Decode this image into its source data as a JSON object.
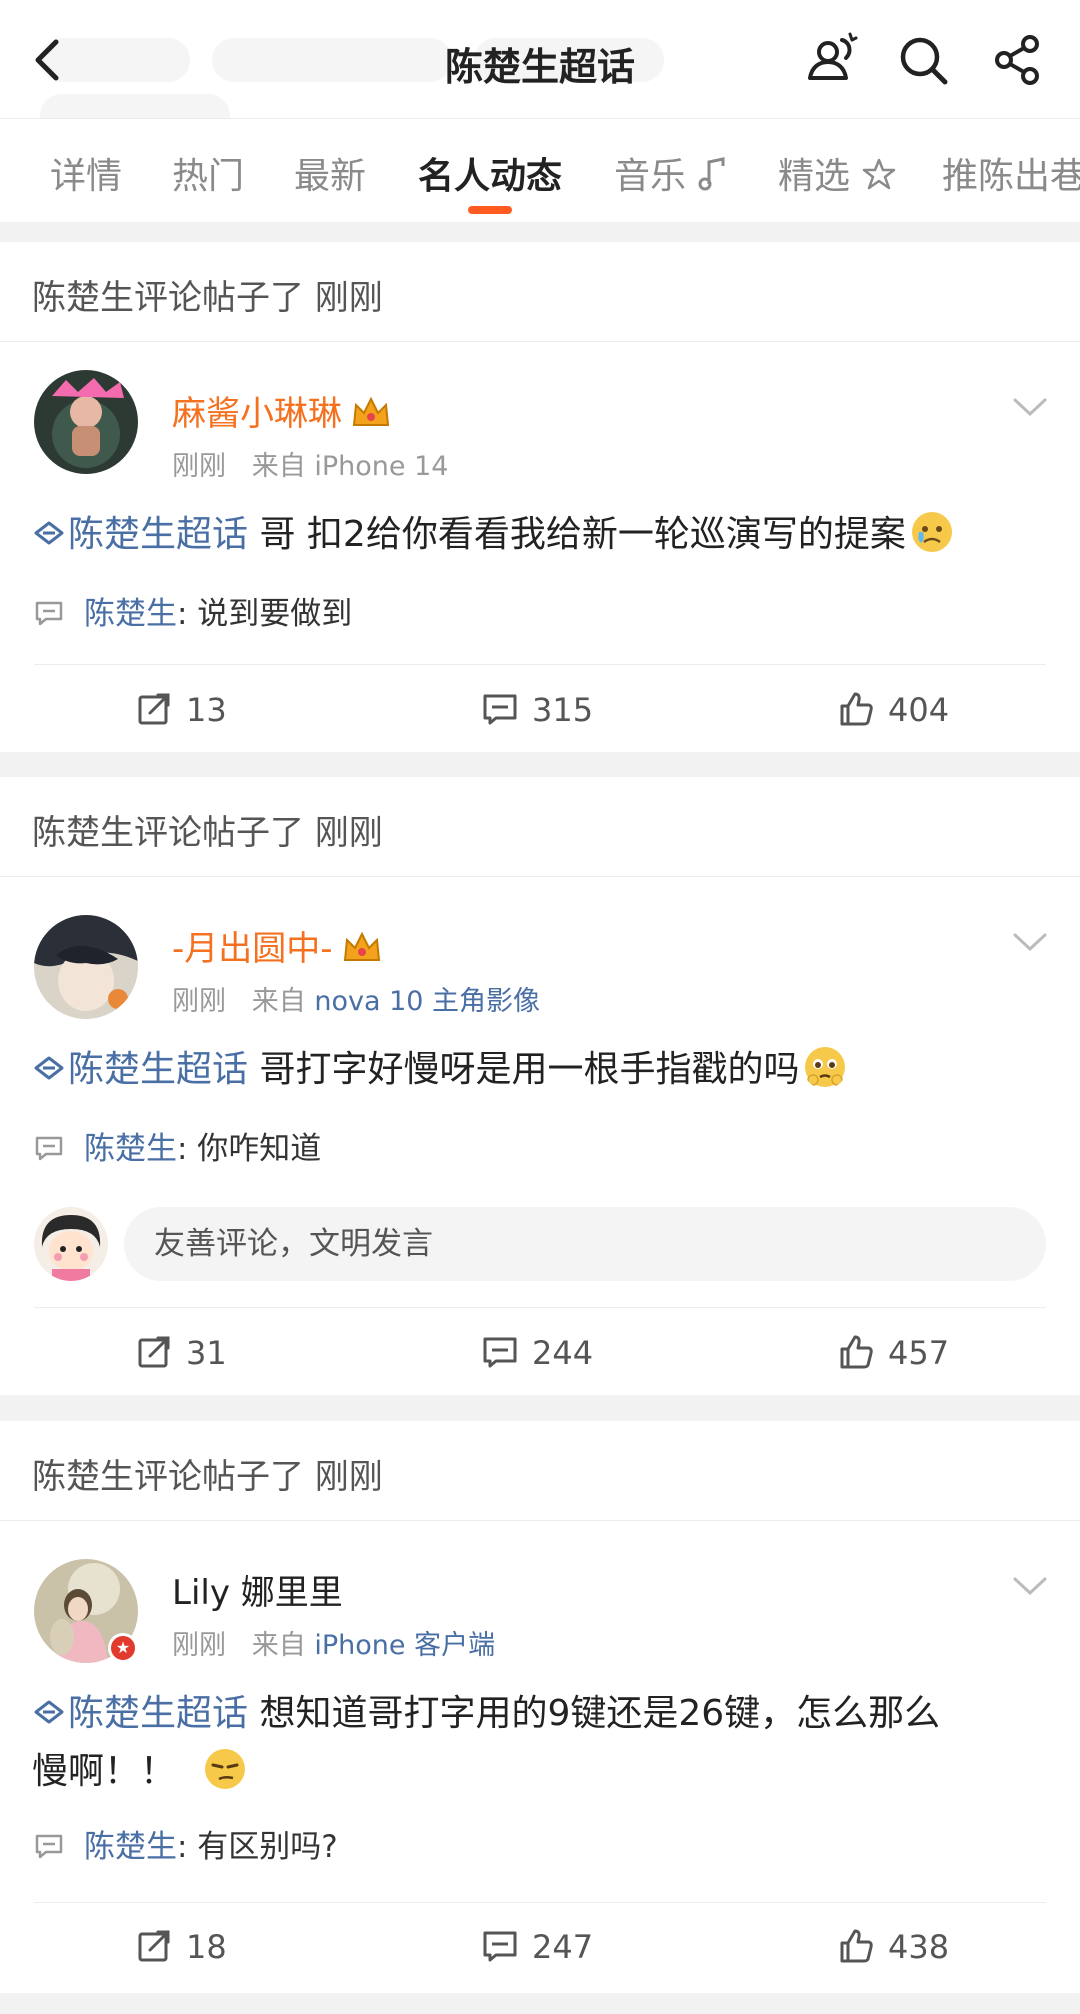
{
  "header": {
    "title": "陈楚生超话",
    "icons": [
      "back-icon",
      "members-icon",
      "search-icon",
      "share-icon"
    ]
  },
  "tabs": [
    {
      "label": "详情"
    },
    {
      "label": "热门"
    },
    {
      "label": "最新"
    },
    {
      "label": "名人动态",
      "active": true
    },
    {
      "label": "音乐"
    },
    {
      "label": "精选"
    },
    {
      "label": "推陈出巷"
    }
  ],
  "colors": {
    "accent": "#ff5a1f",
    "username": "#f5701f",
    "link": "#4a6fa5"
  },
  "posts": [
    {
      "section_label": "陈楚生评论帖子了 刚刚",
      "user": "麻酱小琳琳",
      "time": "刚刚",
      "source_prefix": "来自",
      "source": "iPhone 14",
      "topic": "陈楚生超话",
      "text": "哥 扣2给你看看我给新一轮巡演写的提案",
      "emoji": "teary-emoji",
      "reply_author": "陈楚生",
      "reply_text": ": 说到要做到",
      "reposts": "13",
      "comments": "315",
      "likes": "404"
    },
    {
      "section_label": "陈楚生评论帖子了 刚刚",
      "user": "-月出圆中-",
      "time": "刚刚",
      "source_prefix": "来自",
      "source": "nova 10 主角影像",
      "topic": "陈楚生超话",
      "text": "哥打字好慢呀是用一根手指戳的吗",
      "emoji": "pleading-emoji",
      "reply_author": "陈楚生",
      "reply_text": ": 你咋知道",
      "comment_placeholder": "友善评论，文明发言",
      "reposts": "31",
      "comments": "244",
      "likes": "457"
    },
    {
      "section_label": "陈楚生评论帖子了 刚刚",
      "user": "Lily 娜里里",
      "time": "刚刚",
      "source_prefix": "来自",
      "source": "iPhone 客户端",
      "topic": "陈楚生超话",
      "text_line1": "想知道哥打字用的9键还是26键，怎么那么",
      "text_line2": "慢啊！！",
      "emoji": "thinking-emoji",
      "reply_author": "陈楚生",
      "reply_text": ": 有区别吗?",
      "reposts": "18",
      "comments": "247",
      "likes": "438"
    }
  ]
}
